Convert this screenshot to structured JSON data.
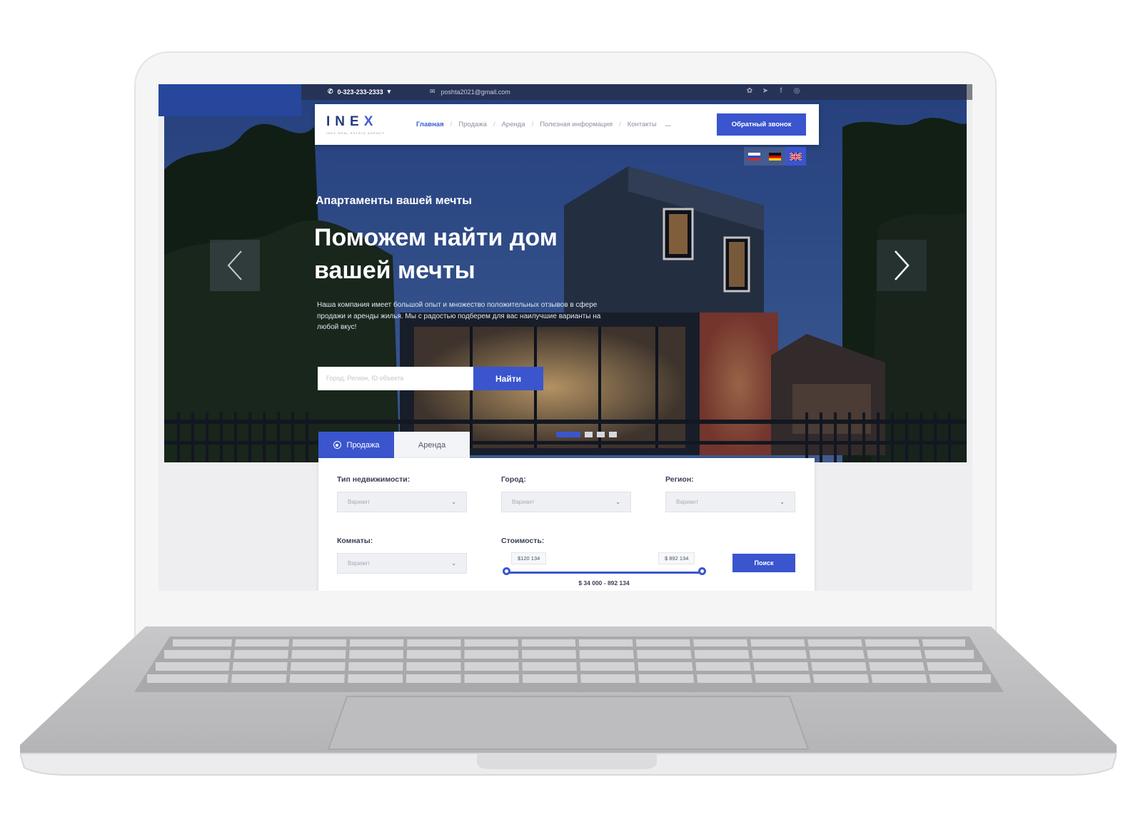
{
  "topbar": {
    "phone": "0-323-233-2333",
    "email": "poshta2021@gmail.com",
    "social_icons": [
      "rss-icon",
      "telegram-icon",
      "facebook-icon",
      "instagram-icon"
    ]
  },
  "brand": {
    "logo_text": "INE",
    "logo_x": "X",
    "tagline": "INEX REAL ESTATE AGENCY"
  },
  "nav": {
    "items": [
      "Главная",
      "Продажа",
      "Аренда",
      "Полезная информация",
      "Контакты"
    ],
    "more": "...",
    "callback_button": "Обратный звонок"
  },
  "languages": [
    "ru",
    "de",
    "en"
  ],
  "hero": {
    "subtitle": "Апартаменты вашей мечты",
    "title": "Поможем найти дом вашей мечты",
    "text": "Наша компания имеет большой опыт и множество положительных отзывов в сфере продажи и аренды жилья. Мы с радостью подберем для вас наилучшие варианты на любой вкус!",
    "search_placeholder": "Город, Регион, ID объекта",
    "search_button": "Найти",
    "slides": 4,
    "active_slide": 1
  },
  "filter": {
    "tabs": [
      "Продажа",
      "Аренда"
    ],
    "active_tab": "Продажа",
    "type_label": "Тип недвижимости:",
    "type_value": "Вариант",
    "city_label": "Город:",
    "city_value": "Вариант",
    "region_label": "Регион:",
    "region_value": "Вариант",
    "rooms_label": "Комнаты:",
    "rooms_value": "Вариант",
    "price_label": "Стоимость:",
    "price_min": "$120 134",
    "price_max": "$ 892 134",
    "price_range": "$ 34 000 - 892 134",
    "search_button": "Поиск"
  },
  "colors": {
    "accent": "#3a55cd",
    "brand_dark": "#243b7c",
    "topbar_blue": "#26479b"
  }
}
